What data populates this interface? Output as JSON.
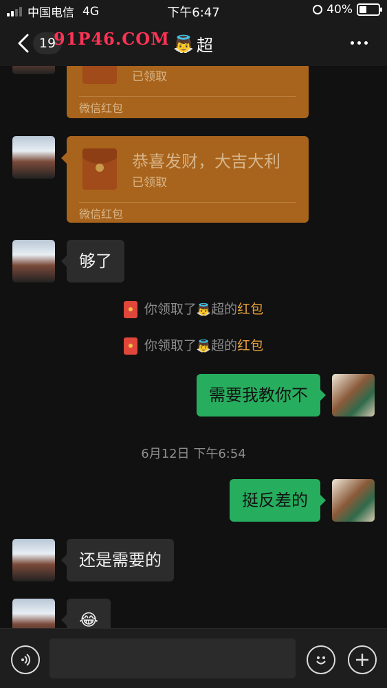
{
  "status_bar": {
    "carrier": "中国电信",
    "network": "4G",
    "time": "下午6:47",
    "battery": "40%"
  },
  "header": {
    "back_count": "19",
    "watermark": "91P46.COM",
    "contact_emoji": "👼",
    "contact_name": "超"
  },
  "messages": {
    "packet_top": {
      "status": "已领取",
      "brand": "微信红包"
    },
    "packet_main": {
      "wish": "恭喜发财，大吉大利",
      "status": "已领取",
      "brand": "微信红包"
    },
    "msg_enough": "够了",
    "sys_1": {
      "prefix": "你领取了",
      "emoji": "👼",
      "name": "超",
      "mid": "的",
      "link": "红包"
    },
    "sys_2": {
      "prefix": "你领取了",
      "emoji": "👼",
      "name": "超",
      "mid": "的",
      "link": "红包"
    },
    "msg_teach": "需要我教你不",
    "timestamp": "6月12日 下午6:54",
    "msg_contrast": "挺反差的",
    "msg_still_need": "还是需要的",
    "msg_emoji": "😂"
  },
  "colors": {
    "bubble_out": "#27ad5e",
    "red_packet": "#a8641c",
    "highlight": "#e9a23b"
  }
}
